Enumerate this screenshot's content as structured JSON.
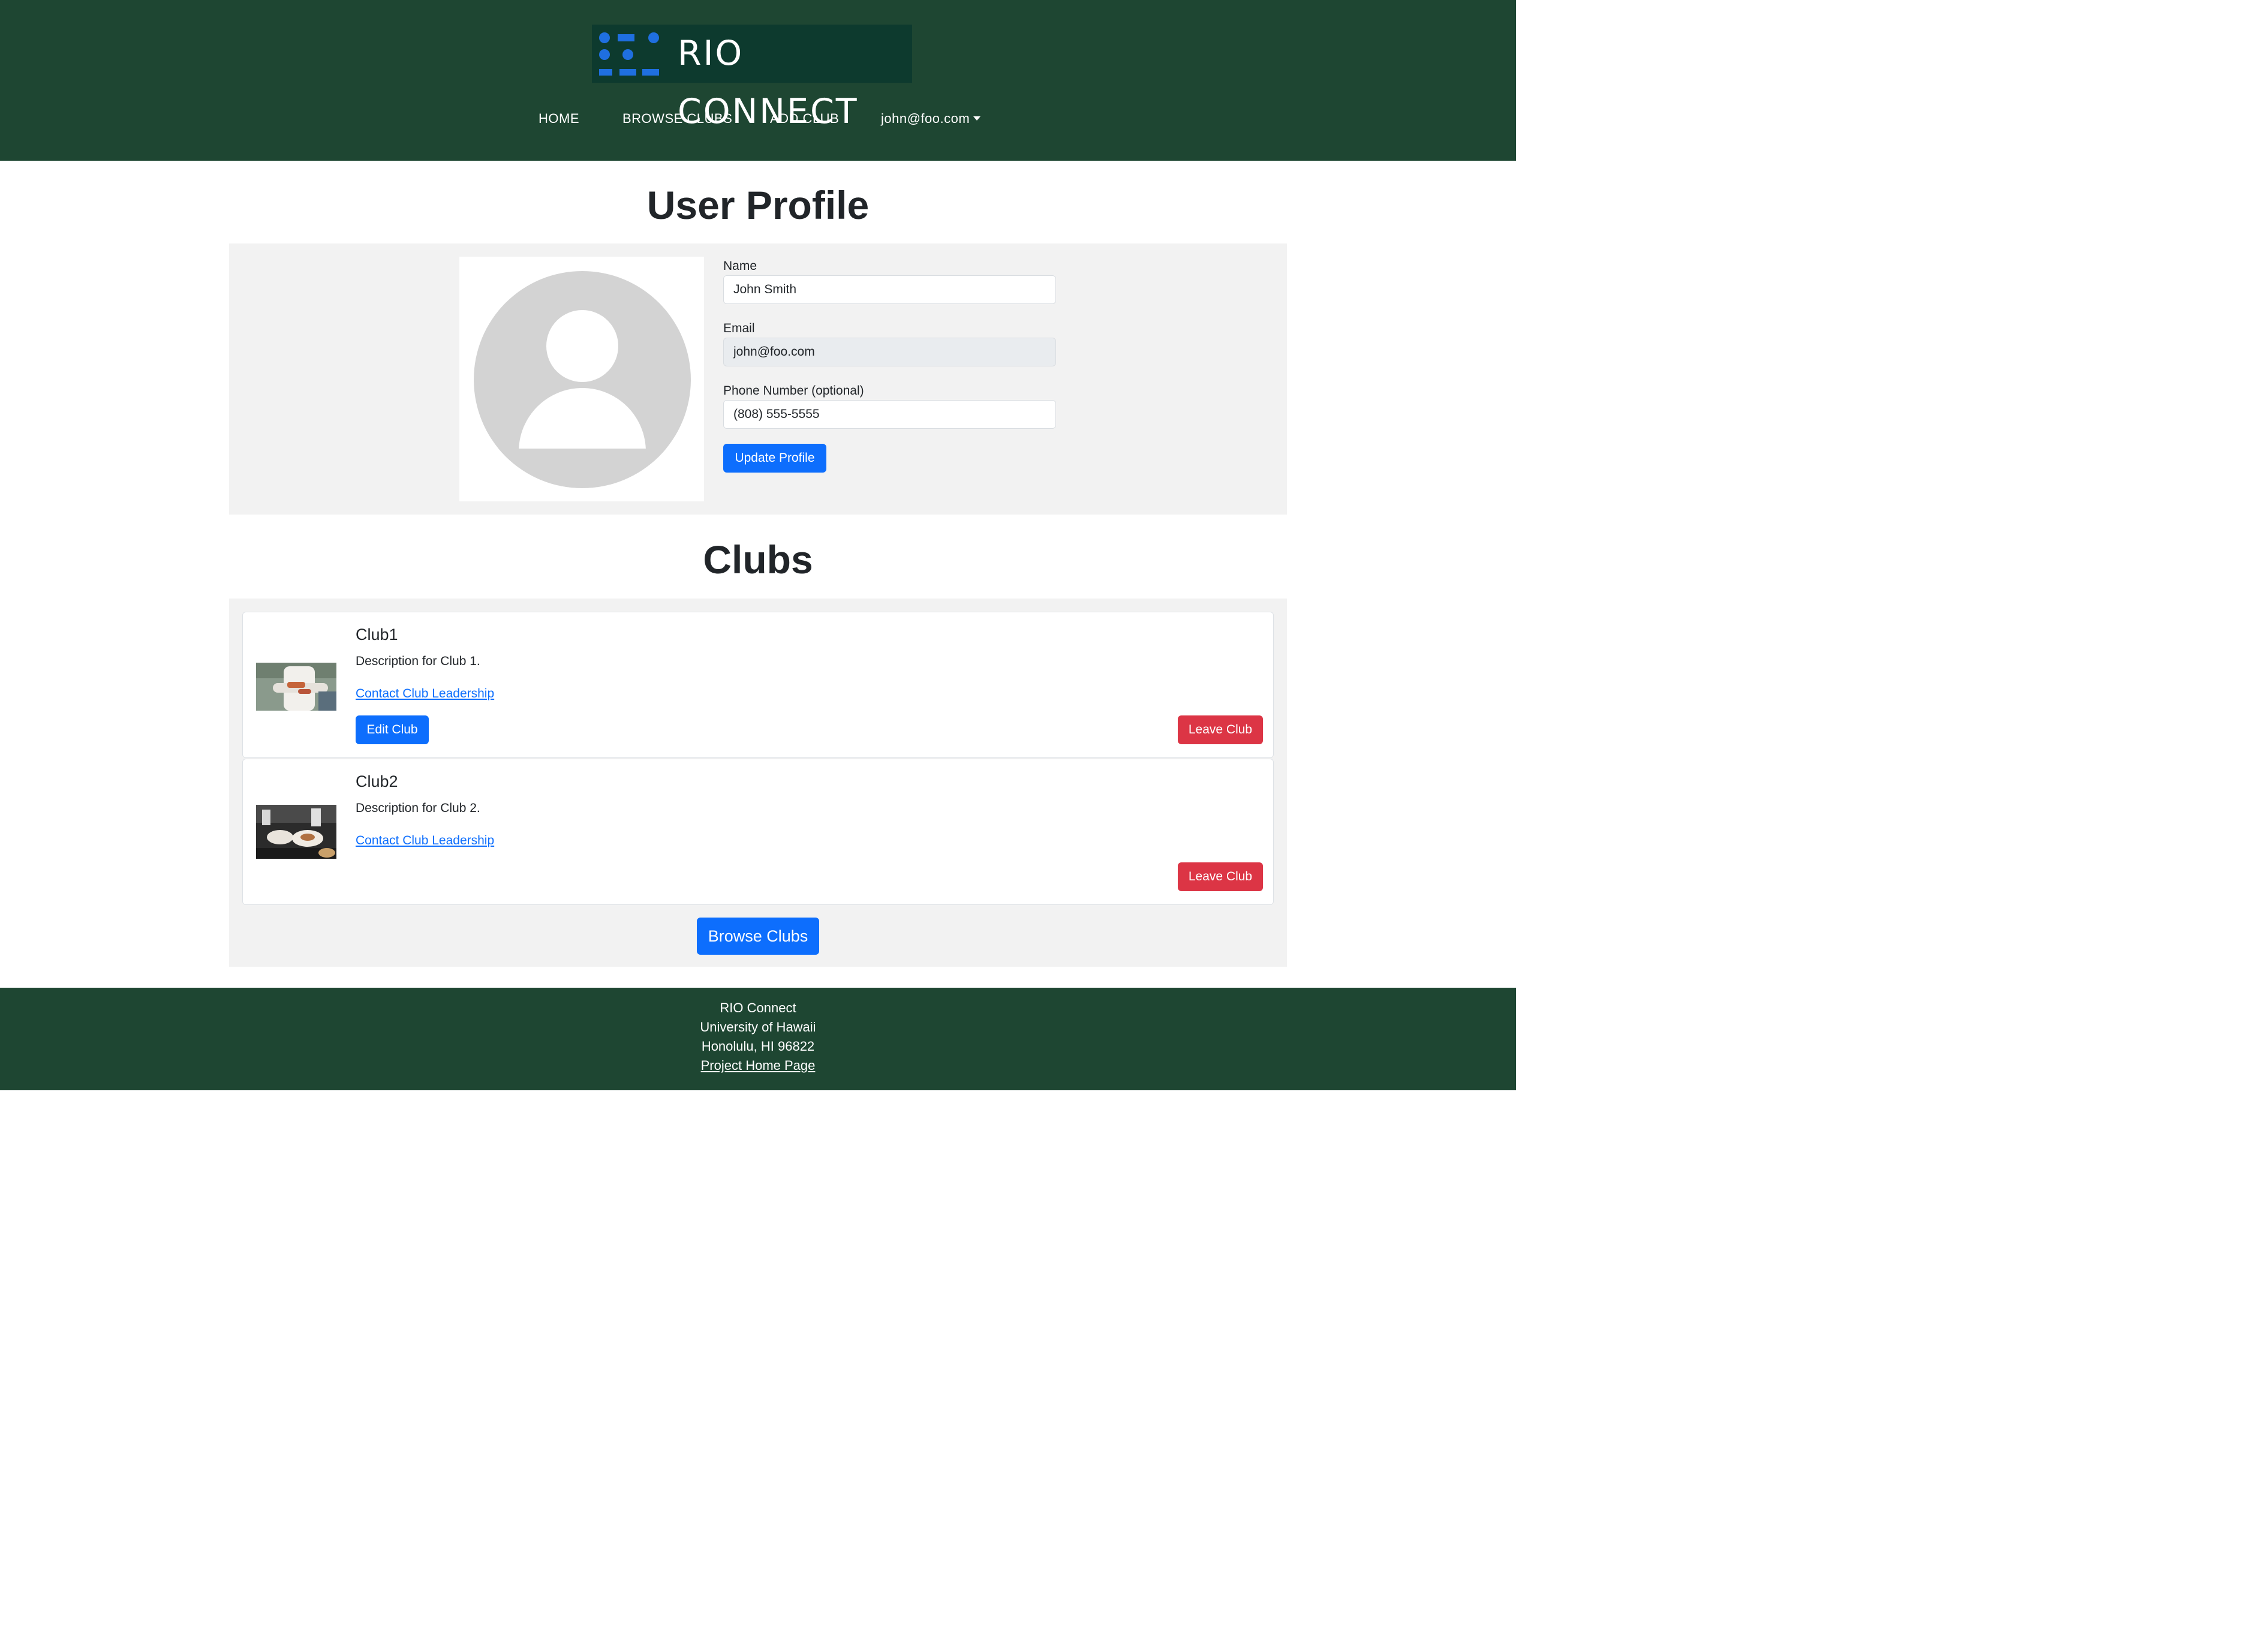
{
  "header": {
    "logo_text": "RIO CONNECT",
    "nav": {
      "home": "HOME",
      "browse_clubs": "BROWSE CLUBS",
      "add_club": "ADD CLUB",
      "user_menu": "john@foo.com"
    }
  },
  "profile": {
    "title": "User Profile",
    "name_label": "Name",
    "name_value": "John Smith",
    "email_label": "Email",
    "email_value": "john@foo.com",
    "phone_label": "Phone Number (optional)",
    "phone_value": "(808) 555-5555",
    "update_button": "Update Profile"
  },
  "clubs": {
    "title": "Clubs",
    "items": [
      {
        "name": "Club1",
        "description": "Description for Club 1.",
        "contact_link": "Contact Club Leadership",
        "edit_button": "Edit Club",
        "leave_button": "Leave Club"
      },
      {
        "name": "Club2",
        "description": "Description for Club 2.",
        "contact_link": "Contact Club Leadership",
        "leave_button": "Leave Club"
      }
    ],
    "browse_button": "Browse Clubs"
  },
  "footer": {
    "line1": "RIO Connect",
    "line2": "University of Hawaii",
    "line3": "Honolulu, HI 96822",
    "link": "Project Home Page"
  },
  "colors": {
    "header_bg": "#1e4632",
    "primary": "#0d6efd",
    "danger": "#dc3545",
    "panel_bg": "#f2f2f2"
  },
  "icons": {
    "logo": "rio-connect-logo-icon",
    "user_menu": "caret-down-icon",
    "avatar": "user-silhouette-icon"
  }
}
